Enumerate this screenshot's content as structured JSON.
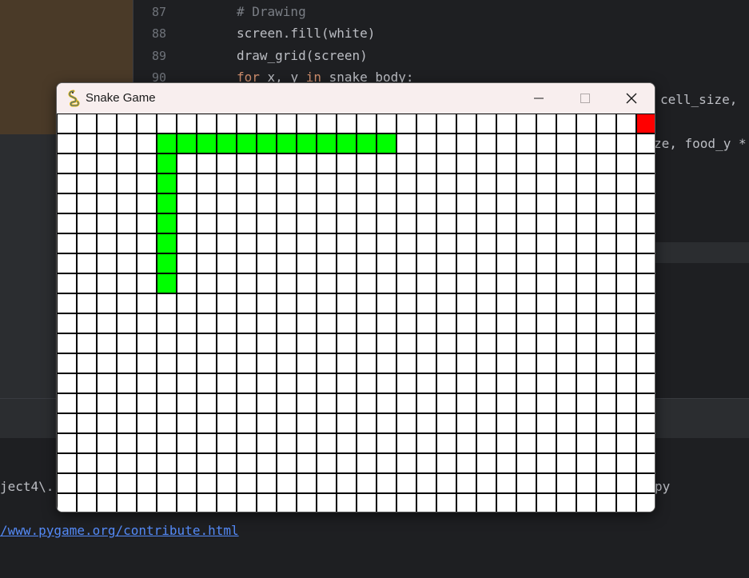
{
  "ide": {
    "line_numbers": [
      "87",
      "88",
      "89",
      "90"
    ],
    "code_lines": [
      {
        "comment": "# Drawing"
      },
      {
        "text": "screen.fill(white)"
      },
      {
        "text": "draw_grid(screen)"
      },
      {
        "kw_for": "for",
        "text_a": " x, y ",
        "kw_in": "in",
        "text_b": " snake_body:"
      }
    ],
    "partial_right_1": "cell_size, ",
    "partial_right_2": "ze, food_y *",
    "run_output_line": "ject4\\.",
    "run_output_suffix": "py",
    "run_link": "/www.pygame.org/contribute.html"
  },
  "window": {
    "title": "Snake Game",
    "buttons": {
      "minimize": "minimize",
      "maximize": "maximize",
      "close": "close"
    }
  },
  "game": {
    "cols": 30,
    "rows": 20,
    "snake_color": "#00ff00",
    "food_color": "#ff0000",
    "grid_line_color": "#000000",
    "background_color": "#ffffff",
    "snake_cells": [
      [
        5,
        1
      ],
      [
        6,
        1
      ],
      [
        7,
        1
      ],
      [
        8,
        1
      ],
      [
        9,
        1
      ],
      [
        10,
        1
      ],
      [
        11,
        1
      ],
      [
        12,
        1
      ],
      [
        13,
        1
      ],
      [
        14,
        1
      ],
      [
        15,
        1
      ],
      [
        16,
        1
      ],
      [
        5,
        2
      ],
      [
        5,
        3
      ],
      [
        5,
        4
      ],
      [
        5,
        5
      ],
      [
        5,
        6
      ],
      [
        5,
        7
      ],
      [
        5,
        8
      ]
    ],
    "food_cell": [
      29,
      0
    ]
  },
  "colors": {
    "ide_background": "#1e1f22",
    "keyword": "#cf8e6d",
    "comment": "#7a7e85",
    "link": "#548af7"
  }
}
